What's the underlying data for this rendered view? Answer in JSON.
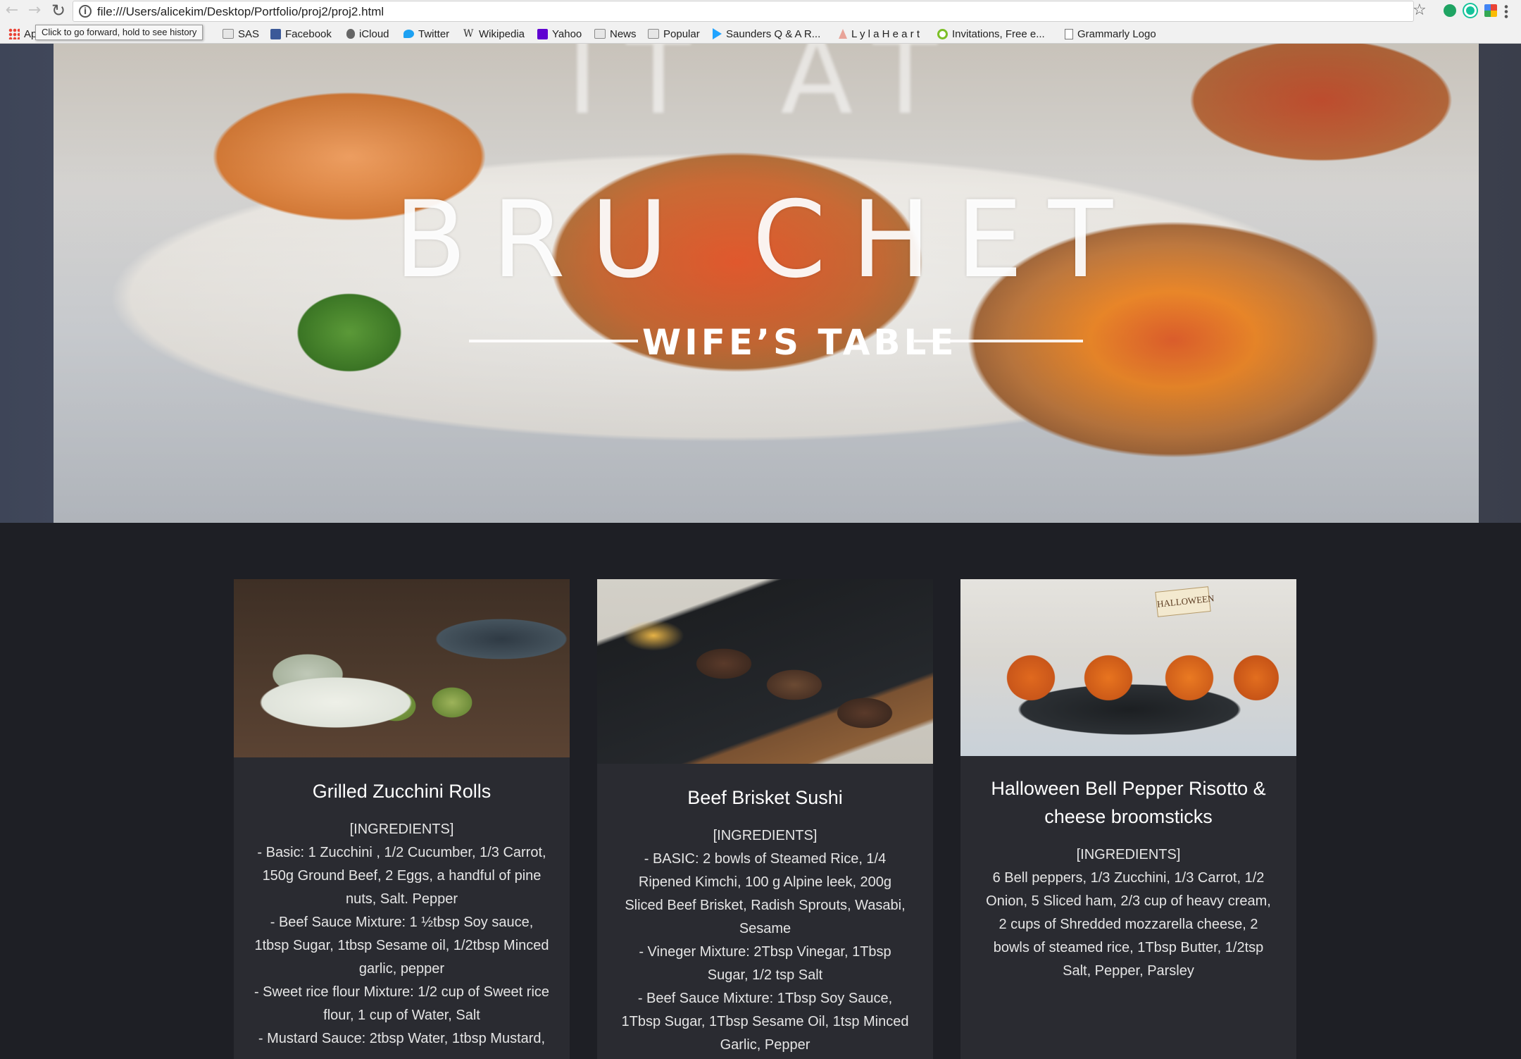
{
  "browser": {
    "url": "file:///Users/alicekim/Desktop/Portfolio/proj2/proj2.html",
    "tooltip": "Click to go forward, hold to see history",
    "bookmarks": [
      {
        "label": "Ap",
        "icon": "apps-icon"
      },
      {
        "label": "SAS",
        "icon": "folder-icon"
      },
      {
        "label": "Facebook",
        "icon": "facebook-icon"
      },
      {
        "label": "iCloud",
        "icon": "apple-icon"
      },
      {
        "label": "Twitter",
        "icon": "twitter-icon"
      },
      {
        "label": "Wikipedia",
        "icon": "wikipedia-icon"
      },
      {
        "label": "Yahoo",
        "icon": "yahoo-icon"
      },
      {
        "label": "News",
        "icon": "folder-icon"
      },
      {
        "label": "Popular",
        "icon": "folder-icon"
      },
      {
        "label": "Saunders Q & A R...",
        "icon": "play-icon"
      },
      {
        "label": "L y l a H e a r t",
        "icon": "lyla-icon"
      },
      {
        "label": "Invitations, Free e...",
        "icon": "invitations-icon"
      },
      {
        "label": "Grammarly Logo",
        "icon": "document-icon"
      }
    ]
  },
  "hero": {
    "title_top": "IT   AT",
    "title": "BRU CHET",
    "subtitle": "WIFE’S TABLE"
  },
  "recipes": [
    {
      "title": "Grilled Zucchini Rolls",
      "ingredients_heading": "[INGREDIENTS]",
      "lines": [
        "- Basic: 1 Zucchini , 1/2 Cucumber, 1/3 Carrot,",
        "150g Ground Beef, 2 Eggs, a handful of pine",
        "nuts, Salt. Pepper",
        "- Beef Sauce Mixture: 1 ½tbsp Soy sauce,",
        "1tbsp Sugar, 1tbsp Sesame oil, 1/2tbsp Minced",
        "garlic, pepper",
        "- Sweet rice flour Mixture: 1/2 cup of Sweet rice",
        "flour, 1 cup of Water, Salt",
        "- Mustard Sauce: 2tbsp Water, 1tbsp Mustard,"
      ]
    },
    {
      "title": "Beef Brisket Sushi",
      "ingredients_heading": "[INGREDIENTS]",
      "lines": [
        "- BASIC: 2 bowls of Steamed Rice, 1/4",
        "Ripened Kimchi, 100 g Alpine leek, 200g",
        "Sliced Beef Brisket, Radish Sprouts, Wasabi,",
        "Sesame",
        "- Vineger Mixture: 2Tbsp Vinegar, 1Tbsp",
        "Sugar, 1/2 tsp Salt",
        "- Beef Sauce Mixture: 1Tbsp Soy Sauce,",
        "1Tbsp Sugar, 1Tbsp Sesame Oil, 1tsp Minced",
        "Garlic, Pepper"
      ]
    },
    {
      "title_line1": "Halloween Bell Pepper Risotto &",
      "title_line2": "cheese broomsticks",
      "photo_flag": "HALLOWEEN",
      "ingredients_heading": "[INGREDIENTS]",
      "lines": [
        "6 Bell peppers, 1/3 Zucchini, 1/3 Carrot, 1/2",
        "Onion, 5 Sliced ham, 2/3 cup of heavy cream,",
        "2 cups of Shredded mozzarella cheese, 2",
        "bowls of steamed rice, 1Tbsp Butter, 1/2tsp",
        "Salt, Pepper, Parsley"
      ]
    }
  ]
}
